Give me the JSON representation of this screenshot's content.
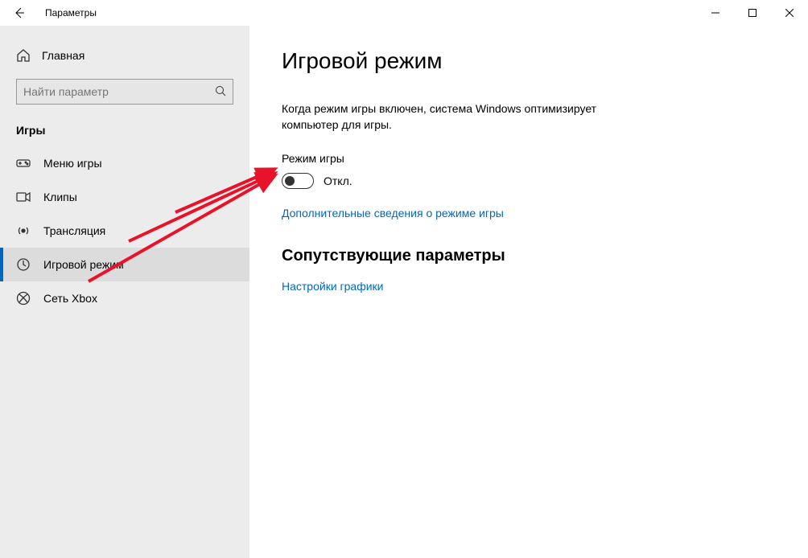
{
  "window": {
    "title": "Параметры"
  },
  "sidebar": {
    "home": "Главная",
    "search_placeholder": "Найти параметр",
    "category": "Игры",
    "items": [
      {
        "label": "Меню игры"
      },
      {
        "label": "Клипы"
      },
      {
        "label": "Трансляция"
      },
      {
        "label": "Игровой режим"
      },
      {
        "label": "Сеть Xbox"
      }
    ]
  },
  "main": {
    "title": "Игровой режим",
    "description": "Когда режим игры включен, система Windows оптимизирует компьютер для игры.",
    "toggle_section_label": "Режим игры",
    "toggle_state": "Откл.",
    "more_info_link": "Дополнительные сведения о режиме игры",
    "related_heading": "Сопутствующие параметры",
    "related_link": "Настройки графики"
  }
}
